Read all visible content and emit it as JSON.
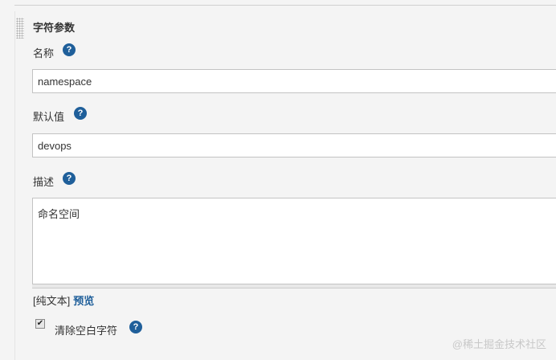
{
  "section": {
    "title": "字符参数"
  },
  "name_field": {
    "label": "名称",
    "value": "namespace"
  },
  "default_field": {
    "label": "默认值",
    "value": "devops"
  },
  "description_field": {
    "label": "描述",
    "value": "命名空间"
  },
  "format": {
    "plain_text": "[纯文本]",
    "preview": "预览"
  },
  "trim_option": {
    "label": "清除空白字符",
    "checked": true
  },
  "help_icon_glyph": "?",
  "watermark": "@稀土掘金技术社区",
  "colors": {
    "accent": "#1f5f9a",
    "border": "#c3c3c3",
    "background": "#f4f4f4"
  }
}
